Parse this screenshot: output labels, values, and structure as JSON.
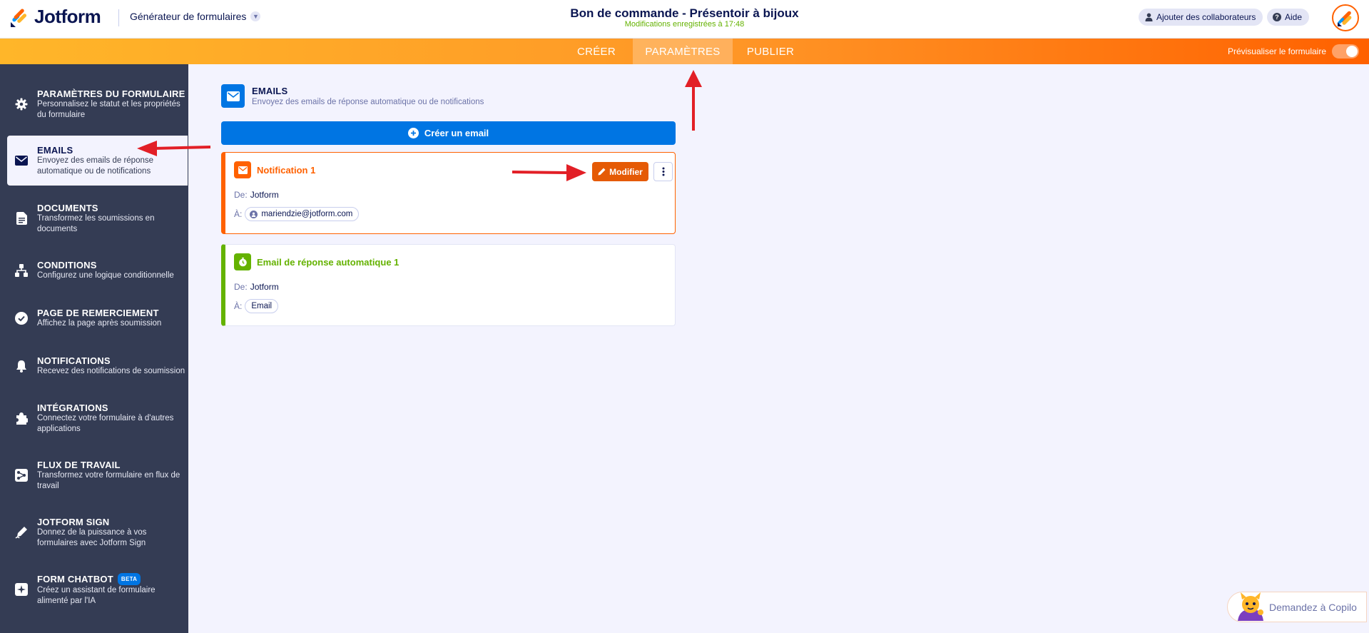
{
  "header": {
    "logo_text": "Jotform",
    "builder_menu": "Générateur de formulaires",
    "form_title": "Bon de commande - Présentoir à bijoux",
    "save_status": "Modifications enregistrées à 17:48",
    "add_collaborators": "Ajouter des collaborateurs",
    "help": "Aide"
  },
  "nav": {
    "tabs": [
      {
        "label": "CRÉER"
      },
      {
        "label": "PARAMÈTRES"
      },
      {
        "label": "PUBLIER"
      }
    ],
    "preview_label": "Prévisualiser le formulaire"
  },
  "sidebar": {
    "items": [
      {
        "title": "PARAMÈTRES DU FORMULAIRE",
        "desc": "Personnalisez le statut et les propriétés du formulaire",
        "icon": "gear-icon"
      },
      {
        "title": "EMAILS",
        "desc": "Envoyez des emails de réponse automatique ou de notifications",
        "icon": "envelope-icon"
      },
      {
        "title": "DOCUMENTS",
        "desc": "Transformez les soumissions en documents",
        "icon": "document-icon"
      },
      {
        "title": "CONDITIONS",
        "desc": "Configurez une logique conditionnelle",
        "icon": "hierarchy-icon"
      },
      {
        "title": "PAGE DE REMERCIEMENT",
        "desc": "Affichez la page après soumission",
        "icon": "check-circle-icon"
      },
      {
        "title": "NOTIFICATIONS",
        "desc": "Recevez des notifications de soumission",
        "icon": "bell-icon"
      },
      {
        "title": "INTÉGRATIONS",
        "desc": "Connectez votre formulaire à d'autres applications",
        "icon": "puzzle-icon"
      },
      {
        "title": "FLUX DE TRAVAIL",
        "desc": "Transformez votre formulaire en flux de travail",
        "icon": "workflow-icon"
      },
      {
        "title": "JOTFORM SIGN",
        "desc": "Donnez de la puissance à vos formulaires avec Jotform Sign",
        "icon": "pen-icon"
      },
      {
        "title": "FORM CHATBOT",
        "desc": "Créez un assistant de formulaire alimenté par l'IA",
        "icon": "chatbot-icon",
        "badge": "BETA"
      }
    ]
  },
  "main": {
    "section_title": "EMAILS",
    "section_desc": "Envoyez des emails de réponse automatique ou de notifications",
    "create_button": "Créer un email",
    "emails": [
      {
        "name": "Notification 1",
        "from_label": "De:",
        "from": "Jotform",
        "to_label": "À:",
        "to": "mariendzie@jotform.com",
        "edit_label": "Modifier",
        "color": "#ff6100"
      },
      {
        "name": "Email de réponse automatique 1",
        "from_label": "De:",
        "from": "Jotform",
        "to_label": "À:",
        "to": "Email",
        "color": "#64b200"
      }
    ]
  },
  "copilot": {
    "label": "Demandez à Copilo"
  },
  "colors": {
    "accent_blue": "#0075e3",
    "accent_orange": "#ff6100",
    "success_green": "#64b200",
    "sidebar_bg": "#343c54",
    "annotation_red": "#e21f26"
  }
}
